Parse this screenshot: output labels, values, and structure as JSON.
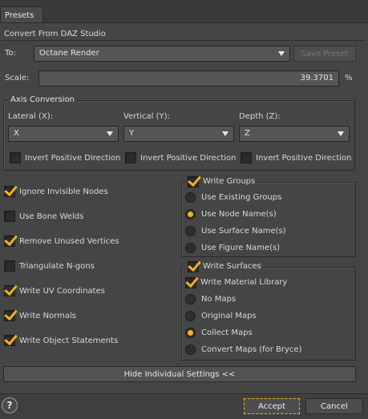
{
  "tab": {
    "label": "Presets"
  },
  "section_title": "Convert From DAZ Studio",
  "to": {
    "label": "To:",
    "value": "Octane Render",
    "save_preset": "Save Preset"
  },
  "scale": {
    "label": "Scale:",
    "value": "39.3701",
    "unit": "%"
  },
  "axis": {
    "title": "Axis Conversion",
    "lateral": {
      "label": "Lateral (X):",
      "value": "X"
    },
    "vertical": {
      "label": "Vertical (Y):",
      "value": "Y"
    },
    "depth": {
      "label": "Depth (Z):",
      "value": "Z"
    },
    "invert_label": "Invert Positive Direction"
  },
  "options": [
    {
      "label": "Ignore Invisible Nodes",
      "checked": true
    },
    {
      "label": "Use Bone Welds",
      "checked": false
    },
    {
      "label": "Remove Unused Vertices",
      "checked": true
    },
    {
      "label": "Triangulate N-gons",
      "checked": false
    },
    {
      "label": "Write UV Coordinates",
      "checked": true
    },
    {
      "label": "Write Normals",
      "checked": true
    },
    {
      "label": "Write Object Statements",
      "checked": true
    }
  ],
  "groups": {
    "title": "Write Groups",
    "checked": true,
    "options": [
      "Use Existing Groups",
      "Use Node Name(s)",
      "Use Surface Name(s)",
      "Use Figure Name(s)"
    ],
    "selected": 1
  },
  "surfaces": {
    "title": "Write Surfaces",
    "checked": true,
    "material_library": "Write Material Library",
    "options": [
      "No Maps",
      "Original Maps",
      "Collect Maps",
      "Convert Maps (for Bryce)"
    ],
    "selected": 2
  },
  "hide_settings": "Hide Individual Settings <<",
  "footer": {
    "help": "?",
    "accept": "Accept",
    "cancel": "Cancel"
  },
  "colors": {
    "accent": "#f2b11e",
    "panel": "#454545",
    "background": "#3a3a3a"
  }
}
